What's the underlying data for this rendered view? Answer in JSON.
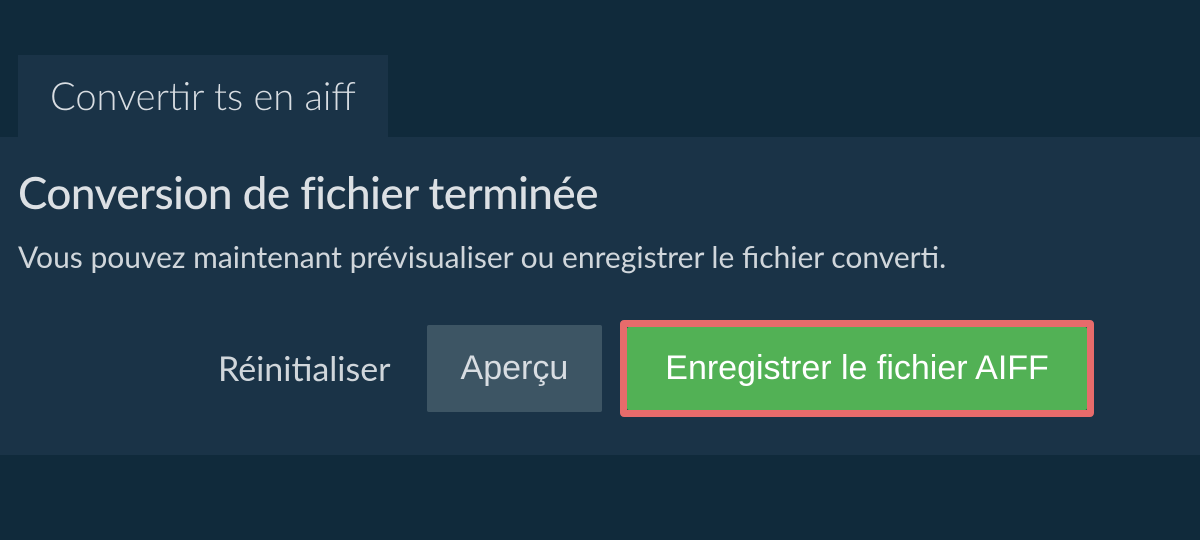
{
  "tab": {
    "label": "Convertir ts en aiff"
  },
  "content": {
    "heading": "Conversion de fichier terminée",
    "subtext": "Vous pouvez maintenant prévisualiser ou enregistrer le fichier converti."
  },
  "actions": {
    "reset_label": "Réinitialiser",
    "preview_label": "Aperçu",
    "save_label": "Enregistrer le fichier AIFF"
  },
  "colors": {
    "background": "#102a3b",
    "panel": "#1a3347",
    "preview_button": "#3d5564",
    "save_button": "#52b155",
    "highlight_border": "#e76b6b"
  }
}
